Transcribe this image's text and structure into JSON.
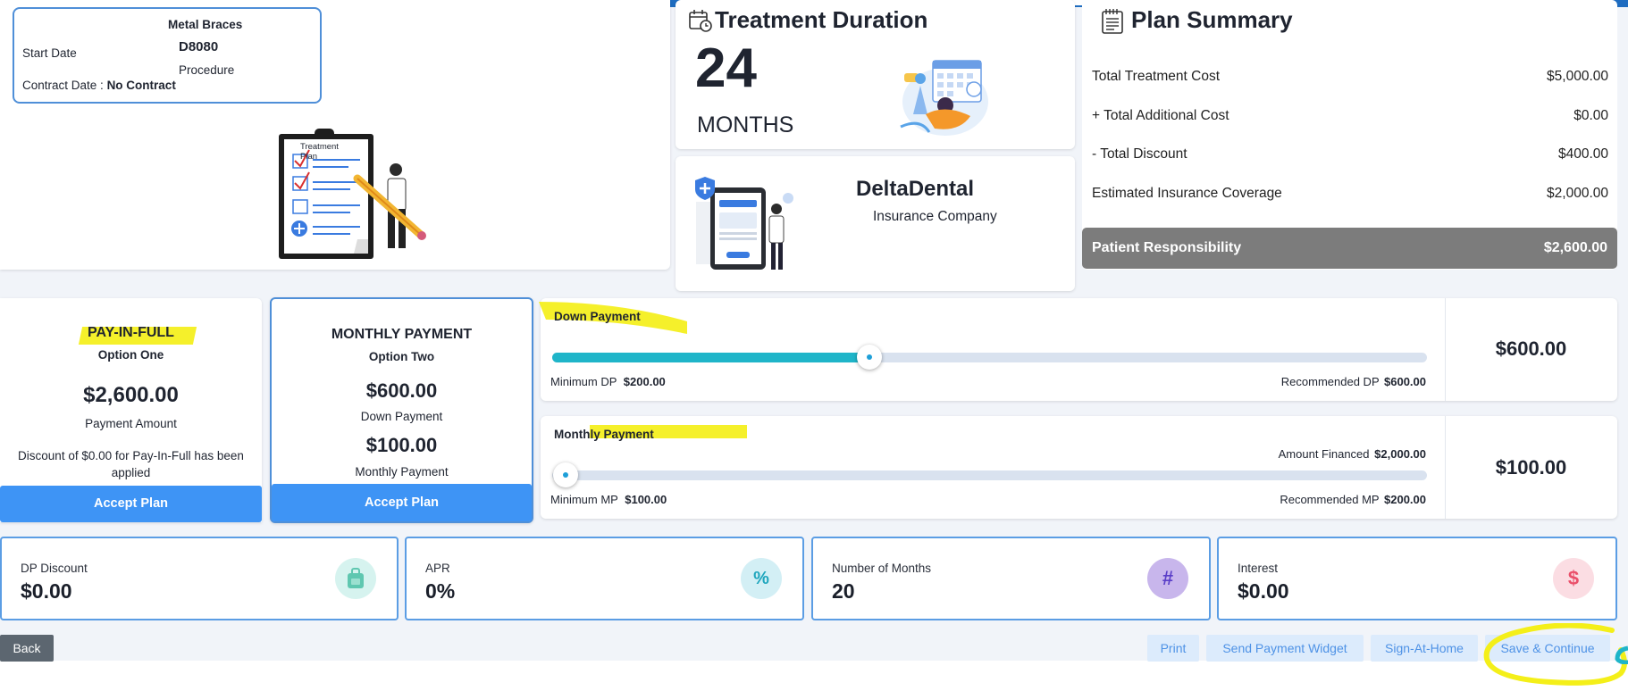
{
  "procedure": {
    "title": "Metal Braces",
    "start_label": "Start Date",
    "code": "D8080",
    "code_label": "Procedure",
    "contract_label": "Contract Date :",
    "contract_value": "No Contract"
  },
  "clipboard_title": "Treatment Plan",
  "duration": {
    "title": "Treatment Duration",
    "value": "24",
    "unit": "MONTHS"
  },
  "insurance": {
    "name": "DeltaDental",
    "subtitle": "Insurance Company"
  },
  "summary": {
    "title": "Plan Summary",
    "rows": [
      {
        "label": "Total Treatment Cost",
        "value": "$5,000.00"
      },
      {
        "label": "+ Total Additional Cost",
        "value": "$0.00"
      },
      {
        "label": "- Total Discount",
        "value": "$400.00"
      },
      {
        "label": "Estimated Insurance Coverage",
        "value": "$2,000.00"
      }
    ],
    "responsibility_label": "Patient Responsibility",
    "responsibility_value": "$2,600.00"
  },
  "option_one": {
    "title": "PAY-IN-FULL",
    "subtitle": "Option One",
    "amount": "$2,600.00",
    "amount_label": "Payment Amount",
    "note": "Discount of $0.00 for Pay-In-Full has been applied",
    "button": "Accept Plan"
  },
  "option_two": {
    "title": "MONTHLY PAYMENT",
    "subtitle": "Option Two",
    "down": "$600.00",
    "down_label": "Down Payment",
    "monthly": "$100.00",
    "monthly_label": "Monthly Payment",
    "button": "Accept Plan"
  },
  "down_payment": {
    "title": "Down Payment",
    "min_label": "Minimum DP",
    "min_value": "$200.00",
    "rec_label": "Recommended DP",
    "rec_value": "$600.00",
    "value": "$600.00",
    "slider_fraction": 0.36
  },
  "monthly_payment": {
    "title": "Monthly Payment",
    "financed_label": "Amount Financed",
    "financed_value": "$2,000.00",
    "min_label": "Minimum MP",
    "min_value": "$100.00",
    "rec_label": "Recommended MP",
    "rec_value": "$200.00",
    "value": "$100.00",
    "slider_fraction": 0.0
  },
  "stats": [
    {
      "label": "DP Discount",
      "value": "$0.00",
      "icon": "discount-bag-icon"
    },
    {
      "label": "APR",
      "value": "0%",
      "icon": "percent-icon"
    },
    {
      "label": "Number of Months",
      "value": "20",
      "icon": "hash-icon",
      "glyph": "#"
    },
    {
      "label": "Interest",
      "value": "$0.00",
      "icon": "dollar-icon",
      "glyph": "$"
    }
  ],
  "footer": {
    "back": "Back",
    "print": "Print",
    "send_widget": "Send Payment Widget",
    "sign_home": "Sign-At-Home",
    "save": "Save & Continue"
  },
  "colors": {
    "accent": "#3e94f5",
    "highlight": "#f4ef19",
    "topbar": "#1e6cc0"
  }
}
